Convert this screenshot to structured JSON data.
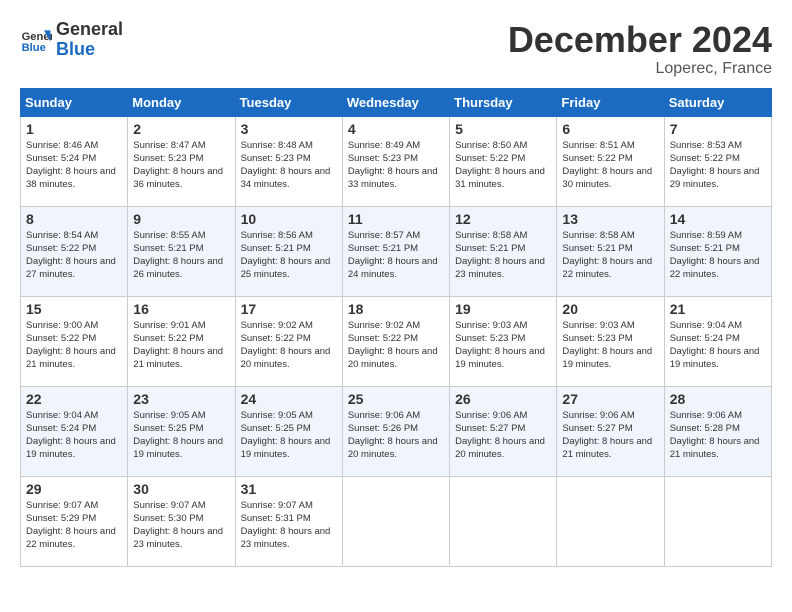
{
  "header": {
    "logo_line1": "General",
    "logo_line2": "Blue",
    "month": "December 2024",
    "location": "Loperec, France"
  },
  "weekdays": [
    "Sunday",
    "Monday",
    "Tuesday",
    "Wednesday",
    "Thursday",
    "Friday",
    "Saturday"
  ],
  "weeks": [
    [
      {
        "day": "1",
        "sunrise": "8:46 AM",
        "sunset": "5:24 PM",
        "daylight": "8 hours and 38 minutes."
      },
      {
        "day": "2",
        "sunrise": "8:47 AM",
        "sunset": "5:23 PM",
        "daylight": "8 hours and 36 minutes."
      },
      {
        "day": "3",
        "sunrise": "8:48 AM",
        "sunset": "5:23 PM",
        "daylight": "8 hours and 34 minutes."
      },
      {
        "day": "4",
        "sunrise": "8:49 AM",
        "sunset": "5:23 PM",
        "daylight": "8 hours and 33 minutes."
      },
      {
        "day": "5",
        "sunrise": "8:50 AM",
        "sunset": "5:22 PM",
        "daylight": "8 hours and 31 minutes."
      },
      {
        "day": "6",
        "sunrise": "8:51 AM",
        "sunset": "5:22 PM",
        "daylight": "8 hours and 30 minutes."
      },
      {
        "day": "7",
        "sunrise": "8:53 AM",
        "sunset": "5:22 PM",
        "daylight": "8 hours and 29 minutes."
      }
    ],
    [
      {
        "day": "8",
        "sunrise": "8:54 AM",
        "sunset": "5:22 PM",
        "daylight": "8 hours and 27 minutes."
      },
      {
        "day": "9",
        "sunrise": "8:55 AM",
        "sunset": "5:21 PM",
        "daylight": "8 hours and 26 minutes."
      },
      {
        "day": "10",
        "sunrise": "8:56 AM",
        "sunset": "5:21 PM",
        "daylight": "8 hours and 25 minutes."
      },
      {
        "day": "11",
        "sunrise": "8:57 AM",
        "sunset": "5:21 PM",
        "daylight": "8 hours and 24 minutes."
      },
      {
        "day": "12",
        "sunrise": "8:58 AM",
        "sunset": "5:21 PM",
        "daylight": "8 hours and 23 minutes."
      },
      {
        "day": "13",
        "sunrise": "8:58 AM",
        "sunset": "5:21 PM",
        "daylight": "8 hours and 22 minutes."
      },
      {
        "day": "14",
        "sunrise": "8:59 AM",
        "sunset": "5:21 PM",
        "daylight": "8 hours and 22 minutes."
      }
    ],
    [
      {
        "day": "15",
        "sunrise": "9:00 AM",
        "sunset": "5:22 PM",
        "daylight": "8 hours and 21 minutes."
      },
      {
        "day": "16",
        "sunrise": "9:01 AM",
        "sunset": "5:22 PM",
        "daylight": "8 hours and 21 minutes."
      },
      {
        "day": "17",
        "sunrise": "9:02 AM",
        "sunset": "5:22 PM",
        "daylight": "8 hours and 20 minutes."
      },
      {
        "day": "18",
        "sunrise": "9:02 AM",
        "sunset": "5:22 PM",
        "daylight": "8 hours and 20 minutes."
      },
      {
        "day": "19",
        "sunrise": "9:03 AM",
        "sunset": "5:23 PM",
        "daylight": "8 hours and 19 minutes."
      },
      {
        "day": "20",
        "sunrise": "9:03 AM",
        "sunset": "5:23 PM",
        "daylight": "8 hours and 19 minutes."
      },
      {
        "day": "21",
        "sunrise": "9:04 AM",
        "sunset": "5:24 PM",
        "daylight": "8 hours and 19 minutes."
      }
    ],
    [
      {
        "day": "22",
        "sunrise": "9:04 AM",
        "sunset": "5:24 PM",
        "daylight": "8 hours and 19 minutes."
      },
      {
        "day": "23",
        "sunrise": "9:05 AM",
        "sunset": "5:25 PM",
        "daylight": "8 hours and 19 minutes."
      },
      {
        "day": "24",
        "sunrise": "9:05 AM",
        "sunset": "5:25 PM",
        "daylight": "8 hours and 19 minutes."
      },
      {
        "day": "25",
        "sunrise": "9:06 AM",
        "sunset": "5:26 PM",
        "daylight": "8 hours and 20 minutes."
      },
      {
        "day": "26",
        "sunrise": "9:06 AM",
        "sunset": "5:27 PM",
        "daylight": "8 hours and 20 minutes."
      },
      {
        "day": "27",
        "sunrise": "9:06 AM",
        "sunset": "5:27 PM",
        "daylight": "8 hours and 21 minutes."
      },
      {
        "day": "28",
        "sunrise": "9:06 AM",
        "sunset": "5:28 PM",
        "daylight": "8 hours and 21 minutes."
      }
    ],
    [
      {
        "day": "29",
        "sunrise": "9:07 AM",
        "sunset": "5:29 PM",
        "daylight": "8 hours and 22 minutes."
      },
      {
        "day": "30",
        "sunrise": "9:07 AM",
        "sunset": "5:30 PM",
        "daylight": "8 hours and 23 minutes."
      },
      {
        "day": "31",
        "sunrise": "9:07 AM",
        "sunset": "5:31 PM",
        "daylight": "8 hours and 23 minutes."
      },
      null,
      null,
      null,
      null
    ]
  ]
}
